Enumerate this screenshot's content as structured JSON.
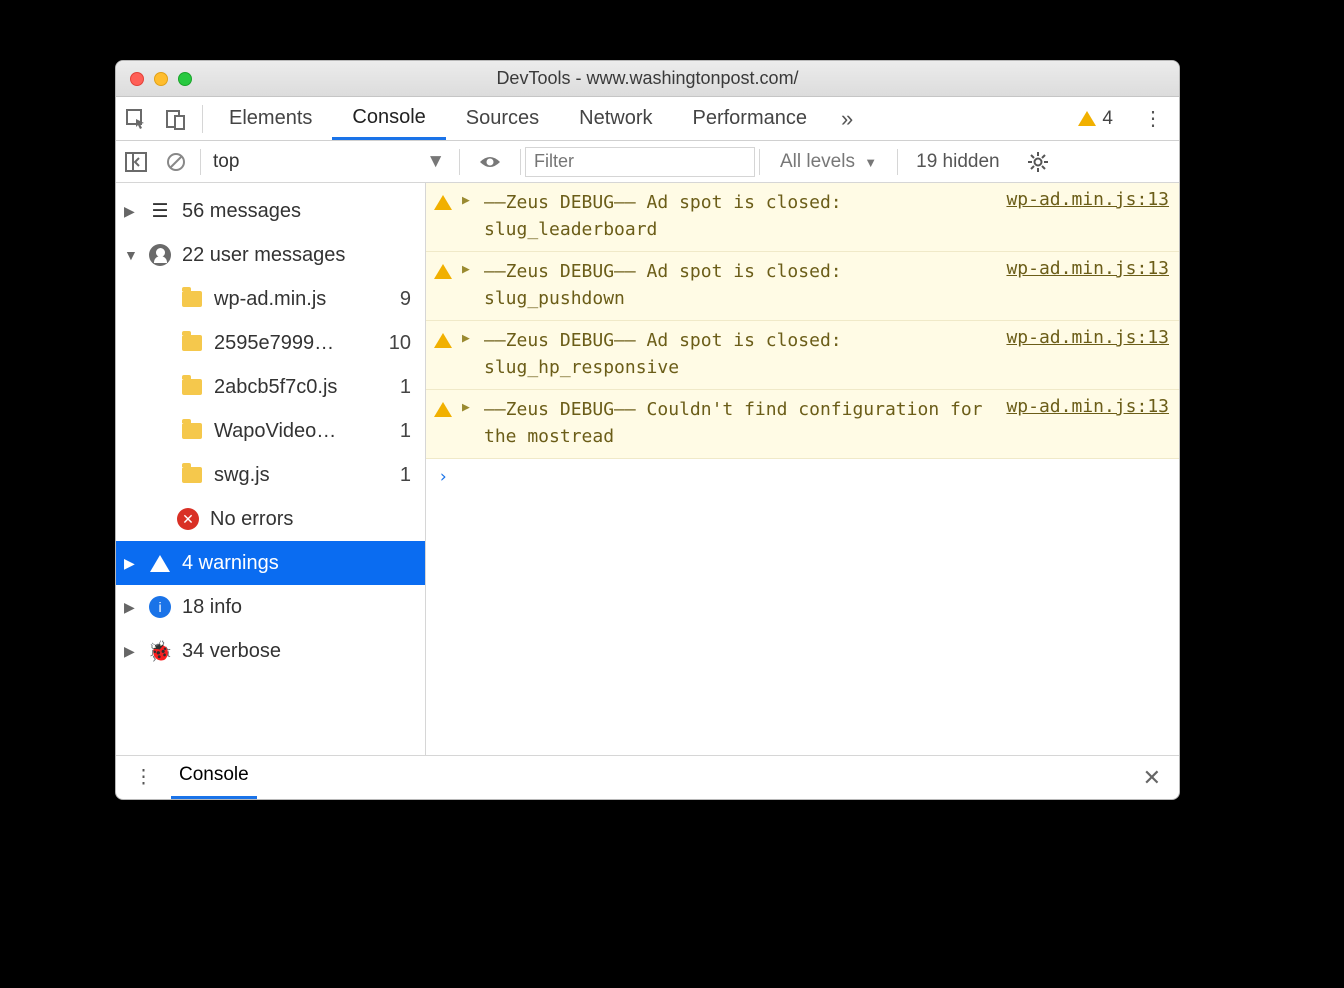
{
  "window": {
    "title": "DevTools - www.washingtonpost.com/"
  },
  "topbar": {
    "tabs": [
      "Elements",
      "Console",
      "Sources",
      "Network",
      "Performance"
    ],
    "active_index": 1,
    "overflow_glyph": "»",
    "warning_count": "4"
  },
  "toolbar": {
    "context": "top",
    "filter_placeholder": "Filter",
    "levels_label": "All levels",
    "hidden_label": "19 hidden"
  },
  "sidebar": {
    "messages": {
      "label": "56 messages"
    },
    "user_messages": {
      "label": "22 user messages",
      "files": [
        {
          "name": "wp-ad.min.js",
          "count": "9"
        },
        {
          "name": "2595e7999…",
          "count": "10"
        },
        {
          "name": "2abcb5f7c0.js",
          "count": "1"
        },
        {
          "name": "WapoVideo…",
          "count": "1"
        },
        {
          "name": "swg.js",
          "count": "1"
        }
      ]
    },
    "errors": {
      "label": "No errors"
    },
    "warnings": {
      "label": "4 warnings"
    },
    "info": {
      "label": "18 info"
    },
    "verbose": {
      "label": "34 verbose"
    }
  },
  "messages": [
    {
      "text": "––Zeus DEBUG–– Ad spot is closed: slug_leaderboard",
      "source": "wp-ad.min.js:13"
    },
    {
      "text": "––Zeus DEBUG–– Ad spot is closed: slug_pushdown",
      "source": "wp-ad.min.js:13"
    },
    {
      "text": "––Zeus DEBUG–– Ad spot is closed: slug_hp_responsive",
      "source": "wp-ad.min.js:13"
    },
    {
      "text": "––Zeus DEBUG–– Couldn't find configuration for the mostread",
      "source": "wp-ad.min.js:13"
    }
  ],
  "prompt": "›",
  "drawer": {
    "tab": "Console"
  }
}
